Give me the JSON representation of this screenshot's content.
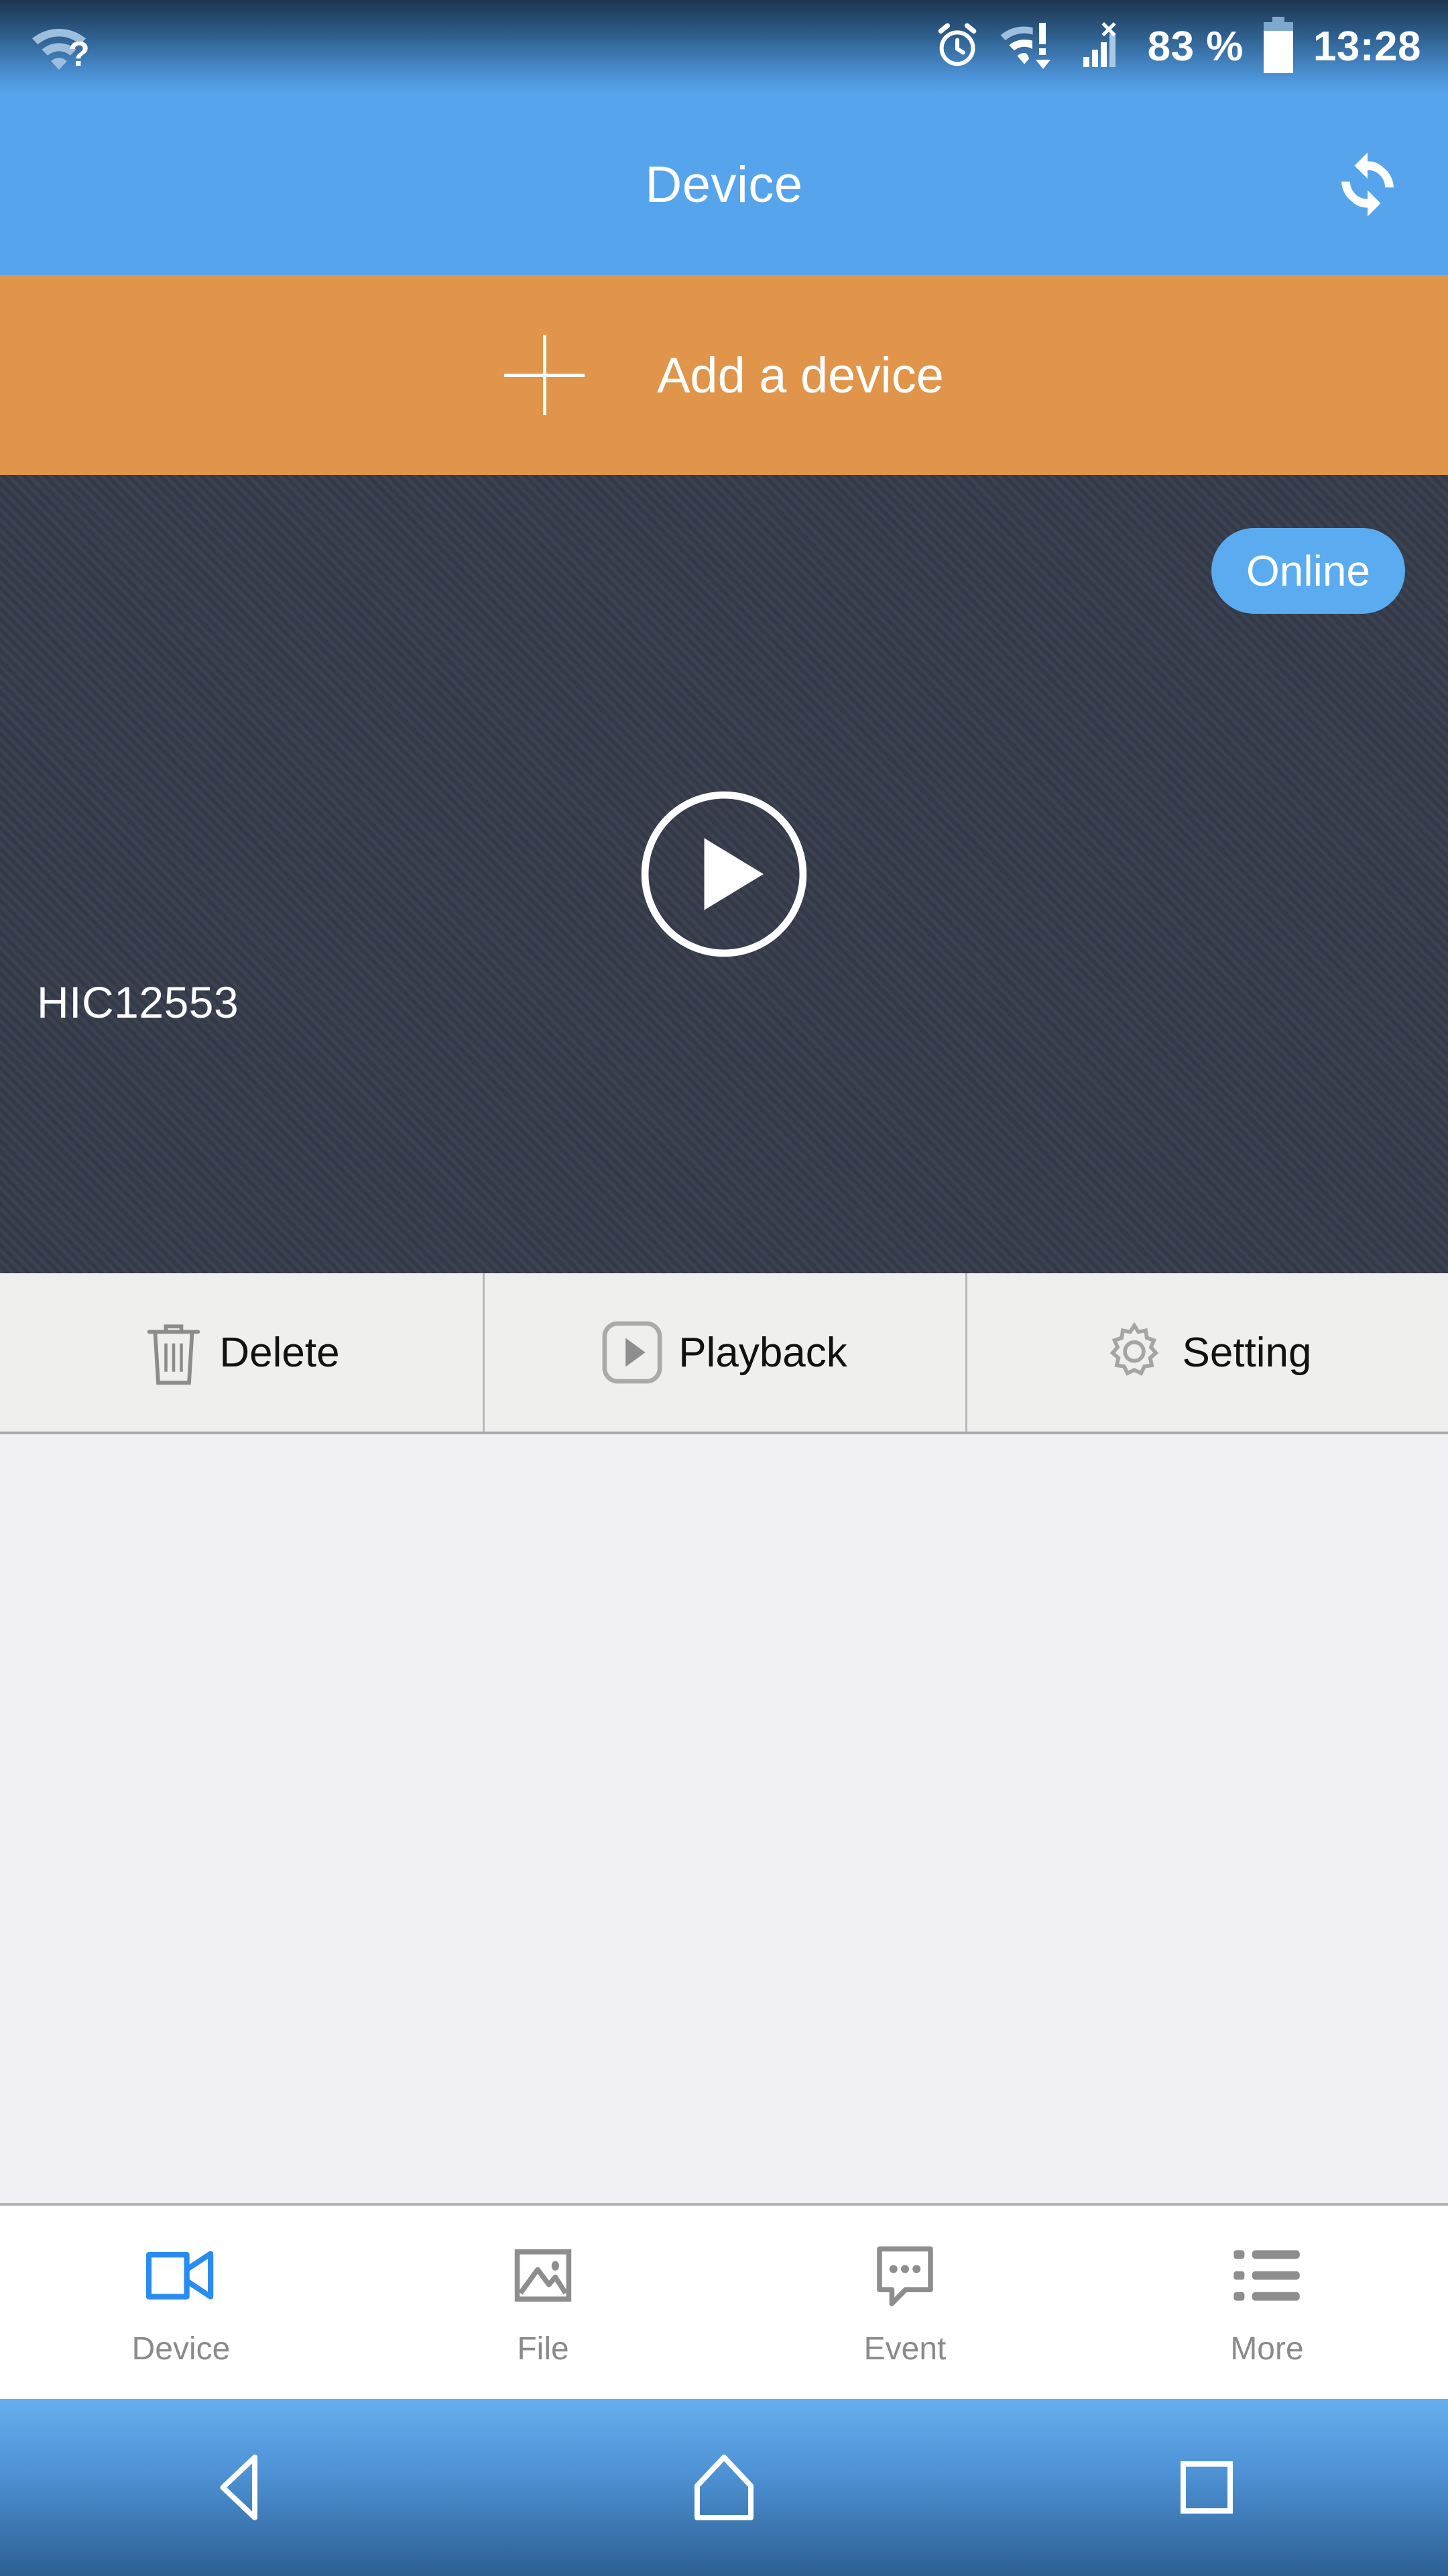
{
  "status_bar": {
    "wifi_question_icon": "wifi-question-icon",
    "alarm_icon": "alarm-clock-icon",
    "wifi_alert_icon": "wifi-alert-icon",
    "signal_icon": "signal-no-sim-icon",
    "battery_percent": "83 %",
    "battery_icon": "battery-icon",
    "time": "13:28"
  },
  "header": {
    "title": "Device",
    "refresh_icon": "refresh-icon"
  },
  "add_device": {
    "label": "Add a device",
    "plus_icon": "plus-icon"
  },
  "device": {
    "name": "HIC12553",
    "status": "Online",
    "play_icon": "play-circle-icon"
  },
  "actions": [
    {
      "label": "Delete",
      "icon": "trash-icon"
    },
    {
      "label": "Playback",
      "icon": "playback-icon"
    },
    {
      "label": "Setting",
      "icon": "gear-icon"
    }
  ],
  "tabs": [
    {
      "label": "Device",
      "icon": "video-camera-icon",
      "active": true
    },
    {
      "label": "File",
      "icon": "image-icon",
      "active": false
    },
    {
      "label": "Event",
      "icon": "speech-bubble-icon",
      "active": false
    },
    {
      "label": "More",
      "icon": "list-icon",
      "active": false
    }
  ],
  "nav_bar": {
    "back_icon": "back-triangle-icon",
    "home_icon": "home-icon",
    "recents_icon": "recents-square-icon"
  },
  "colors": {
    "header_blue": "#56a4ec",
    "accent_orange": "#e0954a",
    "badge_blue": "#5aabf0",
    "tab_active_blue": "#2b8cf0",
    "video_dark": "#363c4b"
  }
}
